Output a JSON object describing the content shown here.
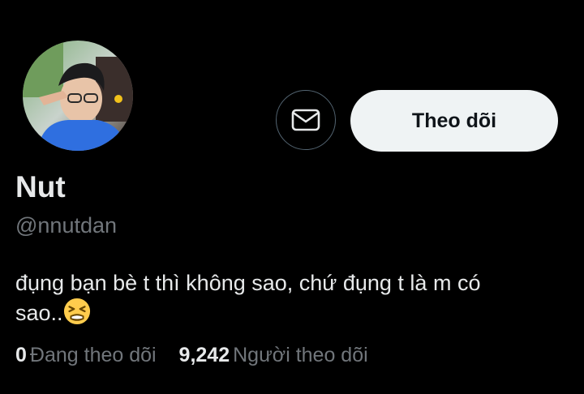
{
  "profile": {
    "display_name": "Nut",
    "handle": "@nnutdan",
    "avatar_icon": "profile-photo",
    "bio_line1": "đụng bạn bè t thì không sao, chứ đụng t là m có",
    "bio_line2": "sao..",
    "bio_emoji": "tired-face-emoji"
  },
  "actions": {
    "message_icon": "envelope-icon",
    "follow_label": "Theo dõi"
  },
  "stats": {
    "following_count": "0",
    "following_label": "Đang theo dõi",
    "followers_count": "9,242",
    "followers_label": "Người theo dõi"
  },
  "colors": {
    "background": "#000000",
    "primary_text": "#e7e9ea",
    "secondary_text": "#71767b",
    "follow_button_bg": "#eff3f4",
    "icon_button_border": "#536471"
  }
}
